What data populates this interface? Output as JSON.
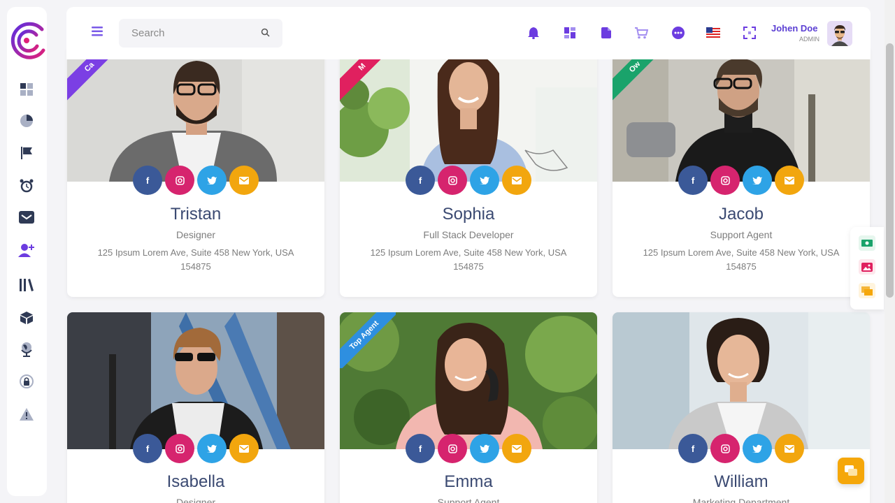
{
  "header": {
    "search_placeholder": "Search",
    "user": {
      "name": "Johen Doe",
      "role": "ADMIN"
    }
  },
  "icons": {
    "sidebar": [
      "dashboard-icon",
      "pie-chart-icon",
      "flag-icon",
      "alarm-icon",
      "mail-icon",
      "add-user-icon",
      "library-icon",
      "cube-icon",
      "globe-icon",
      "lock-icon",
      "warning-icon"
    ],
    "header": [
      "bell-icon",
      "apps-icon",
      "file-icon",
      "cart-icon",
      "chat-icon",
      "us-flag-icon",
      "fullscreen-icon"
    ]
  },
  "colors": {
    "accent": "#6c3ce0",
    "brand_gradient": [
      "#5b2fe0",
      "#e0207a"
    ],
    "name_text": "#3b4a72"
  },
  "cards": [
    {
      "name": "Tristan",
      "role": "Designer",
      "address": "125 Ipsum Lorem Ave, Suite 458 New York, USA 154875",
      "ribbon": "Ca",
      "ribbon_color": "#7b3fe4"
    },
    {
      "name": "Sophia",
      "role": "Full Stack Developer",
      "address": "125 Ipsum Lorem Ave, Suite 458 New York, USA 154875",
      "ribbon": "M",
      "ribbon_color": "#e0205f"
    },
    {
      "name": "Jacob",
      "role": "Support Agent",
      "address": "125 Ipsum Lorem Ave, Suite 458 New York, USA 154875",
      "ribbon": "Ow",
      "ribbon_color": "#1aa36b"
    },
    {
      "name": "Isabella",
      "role": "Designer",
      "address": "",
      "ribbon": "",
      "ribbon_color": ""
    },
    {
      "name": "Emma",
      "role": "Support Agent",
      "address": "",
      "ribbon": "Top Agent",
      "ribbon_color": "#2e8fe0"
    },
    {
      "name": "William",
      "role": "Marketing Department",
      "address": "",
      "ribbon": "",
      "ribbon_color": ""
    }
  ]
}
